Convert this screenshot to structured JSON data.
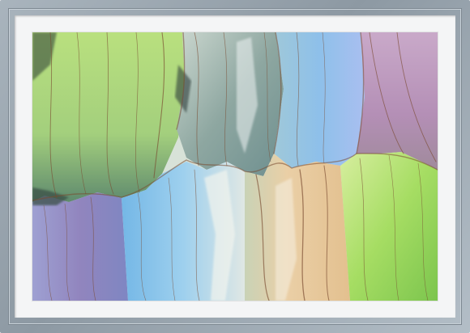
{
  "artwork": {
    "subject": "abstract-alcohol-ink-painting",
    "palette": {
      "green": "#9fd06a",
      "light_green": "#c9e79a",
      "teal_grey": "#8ea7a1",
      "blue": "#86c2ec",
      "lavender": "#a6a6d8",
      "violet": "#8a86b8",
      "sand": "#e2c59a",
      "rose": "#c6a1bf",
      "ink_line": "#7a4a2f",
      "dark_edge": "#3d4a44"
    }
  },
  "frame": {
    "color": "#9aa6b0",
    "mat_color": "#f4f5f6"
  }
}
